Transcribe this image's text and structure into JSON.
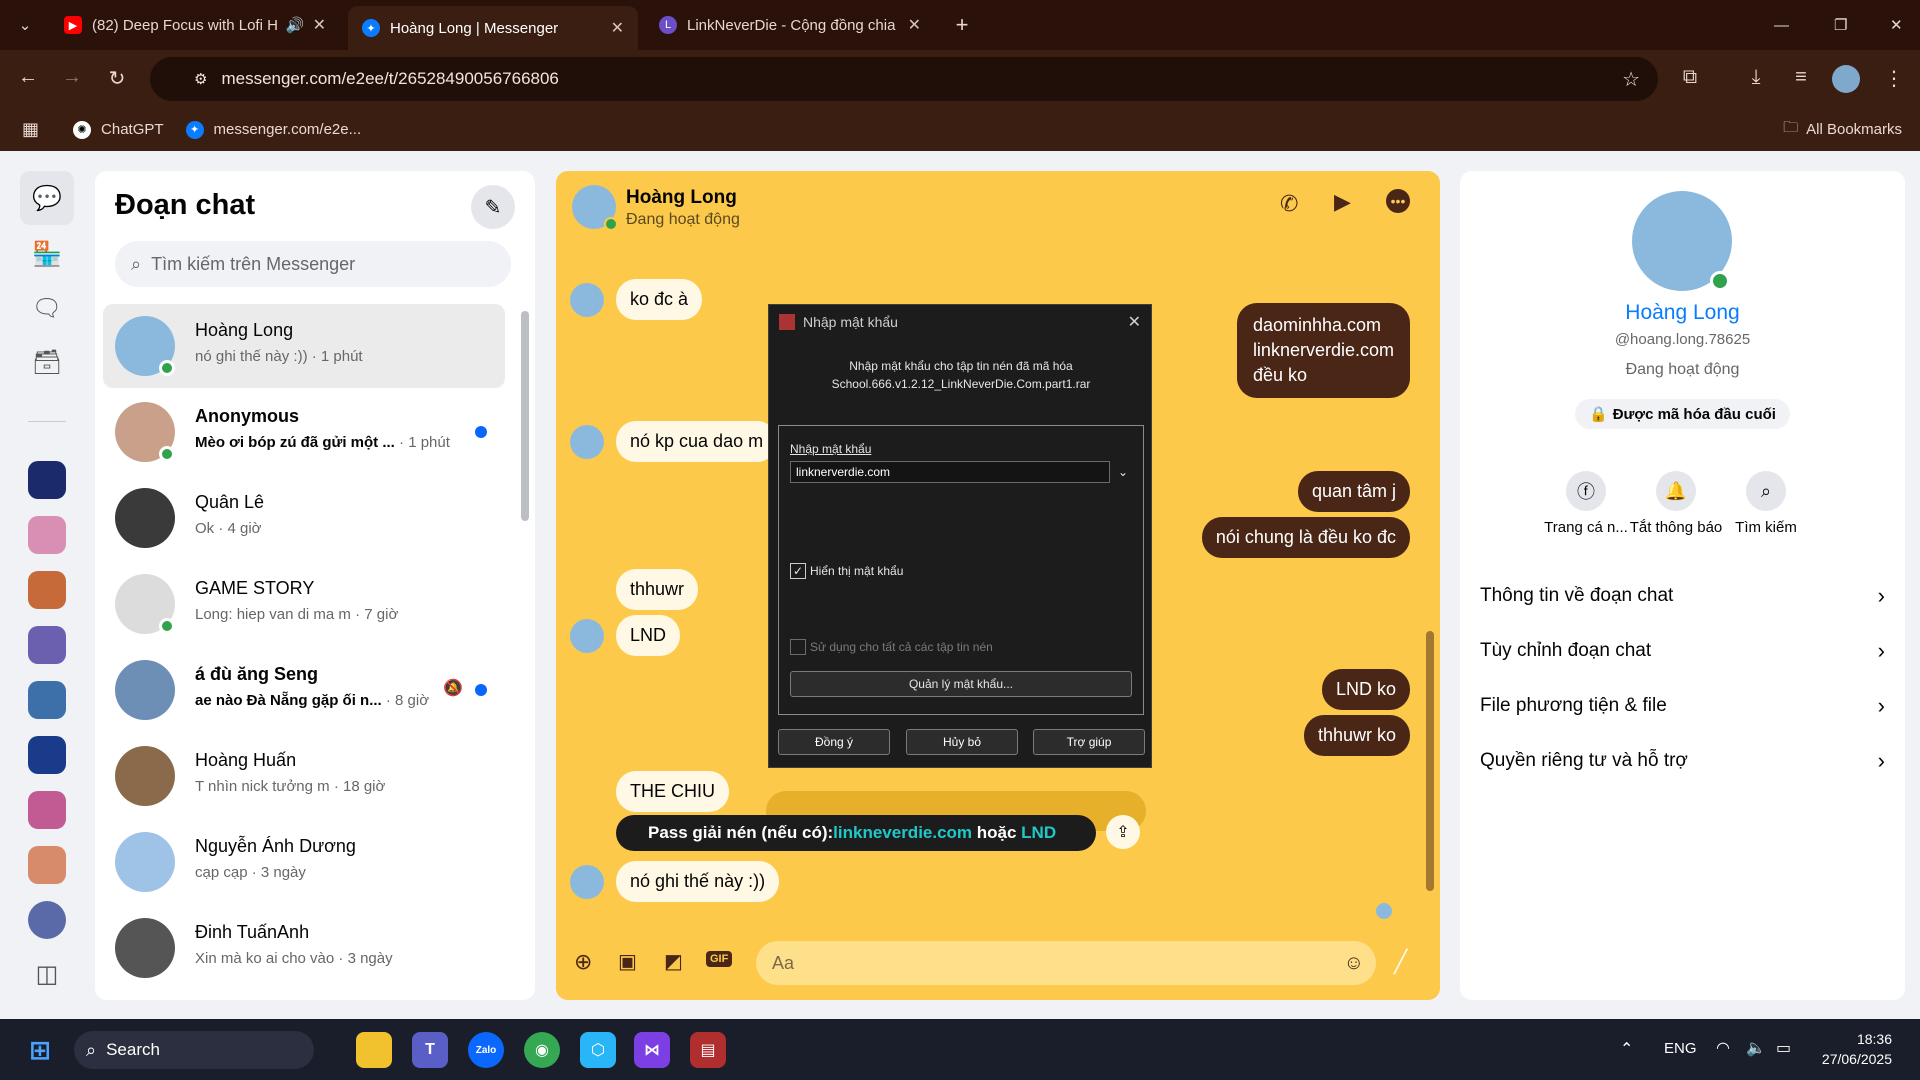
{
  "browser": {
    "tabs": [
      {
        "title": "(82) Deep Focus with Lofi H",
        "favicon": "youtube-icon"
      },
      {
        "title": "Hoàng Long | Messenger",
        "favicon": "messenger-icon"
      },
      {
        "title": "LinkNeverDie - Cộng đồng chia",
        "favicon": "linkneverdie-icon"
      }
    ],
    "url": "messenger.com/e2ee/t/26528490056766806",
    "bookmarks": [
      "ChatGPT",
      "messenger.com/e2e..."
    ],
    "all_bookmarks": "All Bookmarks"
  },
  "list": {
    "title": "Đoạn chat",
    "search_placeholder": "Tìm kiếm trên Messenger",
    "conversations": [
      {
        "name": "Hoàng Long",
        "preview": "nó ghi thế này :)) · 1 phút",
        "active": true,
        "online": true,
        "bold": false
      },
      {
        "name": "Anonymous",
        "preview": "Mèo ơi bóp zú đã gửi một ...",
        "time": " · 1 phút",
        "online": true,
        "bold": true,
        "unread": true
      },
      {
        "name": "Quân Lê",
        "preview": "Ok · 4 giờ",
        "online": false,
        "bold": false
      },
      {
        "name": "GAME STORY",
        "preview": "Long: hiep van di ma m · 7 giờ",
        "online": true,
        "bold": false
      },
      {
        "name": "á đù ăng Seng",
        "preview": "ae nào Đà Nẵng gặp ối n...",
        "time": " · 8 giờ",
        "online": false,
        "bold": true,
        "unread": true,
        "muted": true
      },
      {
        "name": "Hoàng Huấn",
        "preview": "T nhìn nick tưởng m · 18 giờ",
        "online": false,
        "bold": false
      },
      {
        "name": "Nguyễn Ánh Dương",
        "preview": "cạp cạp · 3 ngày",
        "online": false,
        "bold": false
      },
      {
        "name": "Đinh TuấnAnh",
        "preview": "Xin mà ko ai cho vào · 3 ngày",
        "online": false,
        "bold": false
      }
    ]
  },
  "chat": {
    "name": "Hoàng Long",
    "status": "Đang hoạt động",
    "messages": {
      "m1": "ko đc à",
      "m2_a": "daominhha.com",
      "m2_b": "linknerverdie.com",
      "m2_c": "đều ko",
      "m3": "nó kp cua dao m",
      "m4": "quan tâm j",
      "m5": "nói chung là đều ko đc",
      "m6": "thhuwr",
      "m7": "LND",
      "m8": "LND ko",
      "m9": "thhuwr  ko",
      "m10": "THE CHIU",
      "m11": "nó ghi thế này :))"
    },
    "image_banner": {
      "prefix": "Pass giải nén (nếu có): ",
      "link": "linkneverdie.com",
      "mid": " hoặc ",
      "alt": "LND"
    },
    "composer_placeholder": "Aa",
    "accent": "#fcc94a",
    "my_bubble": "#4a2616"
  },
  "dialog": {
    "title": "Nhập mật khẩu",
    "desc_line1": "Nhập mật khẩu cho tập tin nén đã mã hóa",
    "desc_line2": "School.666.v1.2.12_LinkNeverDie.Com.part1.rar",
    "field_label": "Nhập mật khẩu",
    "field_value": "linknerverdie.com",
    "show_password": "Hiển thị mật khẩu",
    "use_for_all": "Sử dụng cho tất cả các tập tin nén",
    "manage": "Quản lý mật khẩu...",
    "ok": "Đồng ý",
    "cancel": "Hủy bỏ",
    "help": "Trợ giúp"
  },
  "profile": {
    "name": "Hoàng Long",
    "handle": "@hoang.long.78625",
    "status": "Đang hoạt động",
    "encrypted": "Được mã hóa đầu cuối",
    "actions": [
      "Trang cá n...",
      "Tắt thông báo",
      "Tìm kiếm"
    ],
    "menu": [
      "Thông tin về đoạn chat",
      "Tùy chỉnh đoạn chat",
      "File phương tiện & file",
      "Quyền riêng tư và hỗ trợ"
    ]
  },
  "taskbar": {
    "search": "Search",
    "lang": "ENG",
    "time": "18:36",
    "date": "27/06/2025"
  }
}
